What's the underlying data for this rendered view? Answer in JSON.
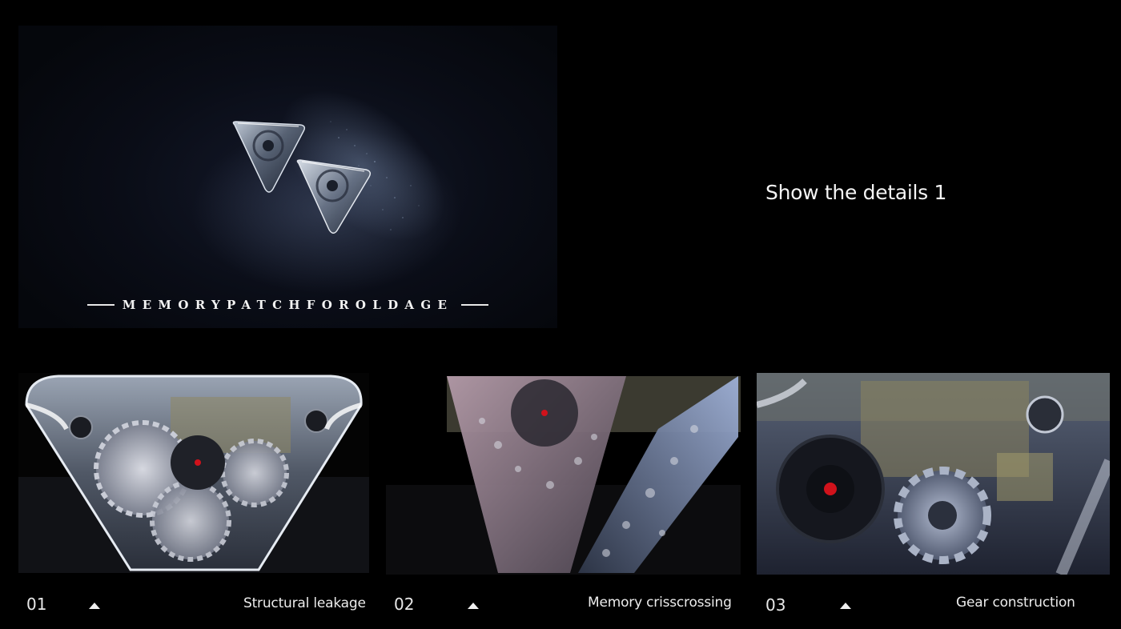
{
  "hero": {
    "title": "MEMORYPATCHFOROLDAGE"
  },
  "section": {
    "heading": "Show the details 1"
  },
  "details": [
    {
      "number": "01",
      "label": "Structural leakage",
      "icon": "triangle-up-icon"
    },
    {
      "number": "02",
      "label": "Memory crisscrossing",
      "icon": "triangle-up-icon"
    },
    {
      "number": "03",
      "label": "Gear construction",
      "icon": "triangle-up-icon"
    }
  ],
  "colors": {
    "background": "#000000",
    "text": "#ffffff",
    "accent_red": "#d0121b"
  }
}
